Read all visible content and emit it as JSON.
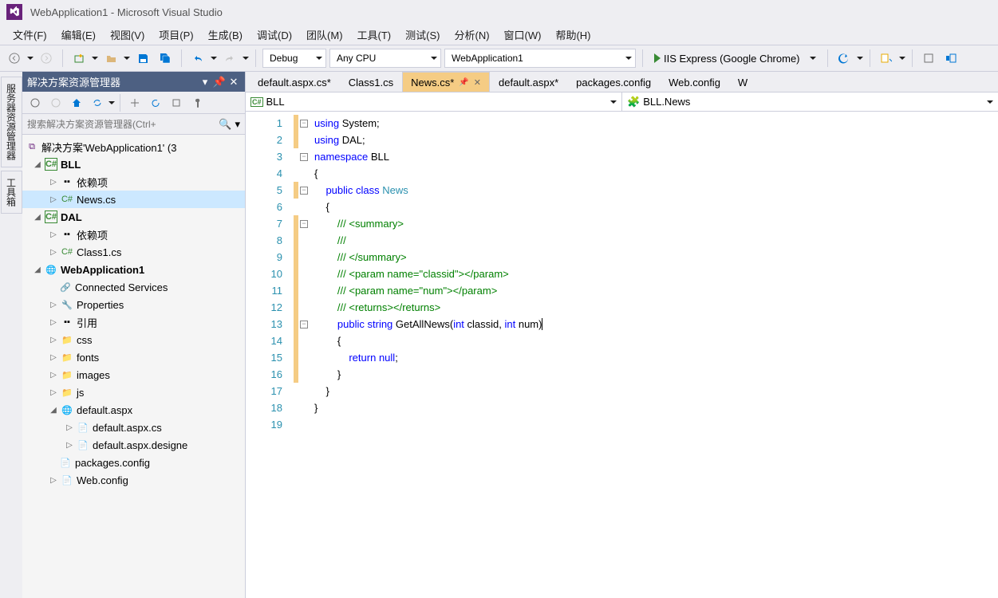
{
  "title": "WebApplication1 - Microsoft Visual Studio",
  "menu": {
    "file": "文件(F)",
    "edit": "编辑(E)",
    "view": "视图(V)",
    "project": "项目(P)",
    "build": "生成(B)",
    "debug": "调试(D)",
    "team": "团队(M)",
    "tools": "工具(T)",
    "test": "测试(S)",
    "analyze": "分析(N)",
    "window": "窗口(W)",
    "help": "帮助(H)"
  },
  "toolbar": {
    "config": "Debug",
    "platform": "Any CPU",
    "startup": "WebApplication1",
    "run": "IIS Express (Google Chrome)"
  },
  "leftTabs": {
    "server": "服务器资源管理器",
    "toolbox": "工具箱"
  },
  "sidebar": {
    "title": "解决方案资源管理器",
    "searchPlaceholder": "搜索解决方案资源管理器(Ctrl+",
    "solution": "解决方案'WebApplication1' (3",
    "bll": "BLL",
    "dal": "DAL",
    "deps": "依赖项",
    "news": "News.cs",
    "class1": "Class1.cs",
    "webapp": "WebApplication1",
    "connsvc": "Connected Services",
    "props": "Properties",
    "refs": "引用",
    "css": "css",
    "fonts": "fonts",
    "images": "images",
    "js": "js",
    "defaspx": "default.aspx",
    "defaspxcs": "default.aspx.cs",
    "defaspxdes": "default.aspx.designe",
    "packages": "packages.config",
    "webconfig": "Web.config"
  },
  "tabs": [
    {
      "label": "default.aspx.cs*",
      "active": false
    },
    {
      "label": "Class1.cs",
      "active": false
    },
    {
      "label": "News.cs*",
      "active": true,
      "pinned": true
    },
    {
      "label": "default.aspx*",
      "active": false
    },
    {
      "label": "packages.config",
      "active": false
    },
    {
      "label": "Web.config",
      "active": false
    },
    {
      "label": "W",
      "active": false
    }
  ],
  "nav": {
    "left": "BLL",
    "right": "BLL.News"
  },
  "code": {
    "l1a": "using",
    "l1b": " System;",
    "l2a": "using",
    "l2b": " DAL;",
    "l3a": "namespace",
    "l3b": " BLL",
    "l4": "{",
    "l5a": "public",
    "l5b": "class",
    "l5c": "News",
    "l6": "{",
    "l7": "/// <summary>",
    "l8": "/// ",
    "l9": "/// </summary>",
    "l10a": "/// <param name=\"",
    "l10b": "classid",
    "l10c": "\"></param>",
    "l11a": "/// <param name=\"",
    "l11b": "num",
    "l11c": "\"></param>",
    "l12": "/// <returns></returns>",
    "l13a": "public",
    "l13b": "string",
    "l13c": "GetAllNews",
    "l13d": "int",
    "l13e": " classid, ",
    "l13f": "int",
    "l13g": " num)",
    "l14": "{",
    "l15a": "return",
    "l15b": "null",
    "l16": "}",
    "l17": "}",
    "l18": "}"
  }
}
